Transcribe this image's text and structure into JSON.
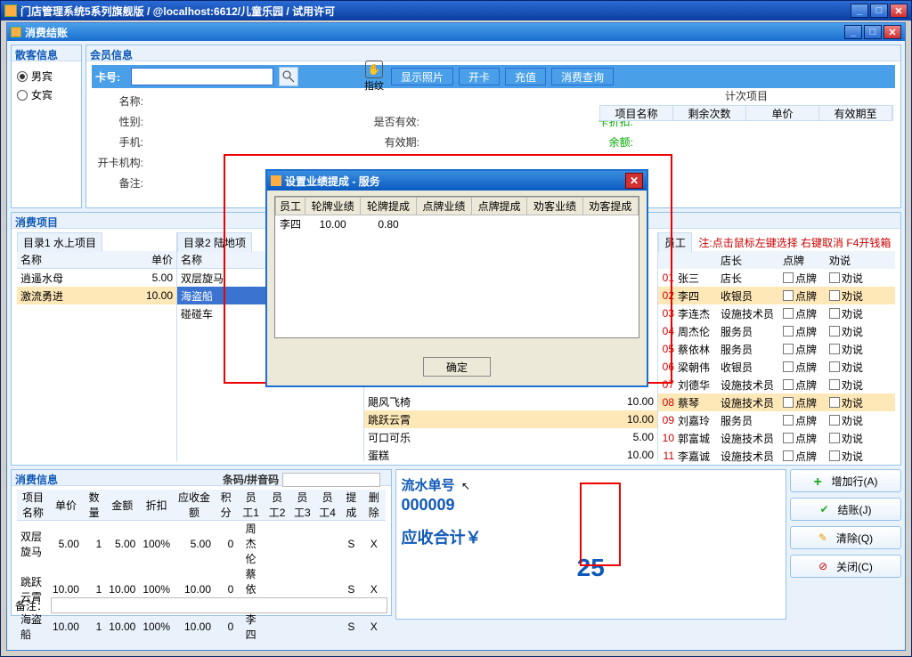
{
  "outer": {
    "title": "门店管理系统5系列旗舰版 / @localhost:6612/儿童乐园 / 试用许可"
  },
  "inner": {
    "title": "消费结账"
  },
  "guest": {
    "header": "散客信息",
    "male": "男宾",
    "female": "女宾"
  },
  "member": {
    "header": "会员信息",
    "labels": {
      "card": "卡号:",
      "name": "名称:",
      "sex": "性别:",
      "phone": "手机:",
      "org": "开卡机构:",
      "remark": "备注:",
      "valid": "是否有效:",
      "exp": "有效期:",
      "discount": "卡折扣:",
      "balance": "余额:"
    },
    "finger": "指纹",
    "btns": {
      "photo": "显示照片",
      "open": "开卡",
      "recharge": "充值",
      "query": "消费查询"
    },
    "count_title": "计次项目",
    "count_cols": [
      "项目名称",
      "剩余次数",
      "单价",
      "有效期至"
    ]
  },
  "xiaofei": {
    "header": "消费项目",
    "tab1": "目录1 水上项目",
    "tab2": "目录2 陆地项",
    "staff_tab": "员工",
    "staff_note": "注:点击鼠标左键选择 右键取消 F4开钱箱",
    "cols": {
      "name": "名称",
      "price": "单价"
    },
    "cat1": [
      {
        "name": "逍遥水母",
        "price": "5.00"
      },
      {
        "name": "激流勇进",
        "price": "10.00",
        "hi": true
      }
    ],
    "cat2": [
      {
        "name": "双层旋马"
      },
      {
        "name": "海盗船",
        "sel": true
      },
      {
        "name": "碰碰车"
      }
    ],
    "cat3": [
      {
        "name": "飓风飞椅",
        "price": "10.00"
      },
      {
        "name": "跳跃云霄",
        "price": "10.00",
        "hi": true
      },
      {
        "name": "可口可乐",
        "price": "5.00"
      },
      {
        "name": "蛋糕",
        "price": "10.00"
      }
    ],
    "staff_cols": [
      "店长",
      "点牌",
      "劝说"
    ],
    "staff": [
      {
        "no": "01",
        "name": "张三",
        "role": "店长"
      },
      {
        "no": "02",
        "name": "李四",
        "role": "收银员",
        "hi": true
      },
      {
        "no": "03",
        "name": "李连杰",
        "role": "设施技术员"
      },
      {
        "no": "04",
        "name": "周杰伦",
        "role": "服务员"
      },
      {
        "no": "05",
        "name": "蔡依林",
        "role": "服务员"
      },
      {
        "no": "06",
        "name": "梁朝伟",
        "role": "收银员"
      },
      {
        "no": "07",
        "name": "刘德华",
        "role": "设施技术员"
      },
      {
        "no": "08",
        "name": "蔡琴",
        "role": "设施技术员",
        "hi": true
      },
      {
        "no": "09",
        "name": "刘嘉玲",
        "role": "服务员"
      },
      {
        "no": "10",
        "name": "郭富城",
        "role": "设施技术员"
      },
      {
        "no": "11",
        "name": "李嘉诚",
        "role": "设施技术员"
      }
    ],
    "pair_labels": {
      "dp": "点牌",
      "qs": "劝说"
    }
  },
  "xinfo": {
    "header": "消费信息",
    "barcode_label": "条码/拼音码",
    "cols": [
      "项目名称",
      "单价",
      "数量",
      "金额",
      "折扣",
      "应收金额",
      "积分",
      "员工1",
      "员工2",
      "员工3",
      "员工4",
      "提成",
      "删除"
    ],
    "rows": [
      {
        "name": "双层旋马",
        "price": "5.00",
        "qty": "1",
        "amt": "5.00",
        "disc": "100%",
        "due": "5.00",
        "pts": "0",
        "e1": "周杰伦",
        "tc": "S",
        "del": "X"
      },
      {
        "name": "跳跃云霄",
        "price": "10.00",
        "qty": "1",
        "amt": "10.00",
        "disc": "100%",
        "due": "10.00",
        "pts": "0",
        "e1": "蔡依林",
        "tc": "S",
        "del": "X"
      },
      {
        "name": "海盗船",
        "price": "10.00",
        "qty": "1",
        "amt": "10.00",
        "disc": "100%",
        "due": "10.00",
        "pts": "0",
        "e1": "李四",
        "tc": "S",
        "del": "X"
      }
    ],
    "remark_label": "备注："
  },
  "summary": {
    "serial_label": "流水单号",
    "serial": "000009",
    "due_label": "应收合计￥",
    "due": "25"
  },
  "actions": {
    "add": "增加行(A)",
    "pay": "结账(J)",
    "clear": "清除(Q)",
    "close": "关闭(C)"
  },
  "modal": {
    "title": "设置业绩提成 - 服务",
    "cols": [
      "员工",
      "轮牌业绩",
      "轮牌提成",
      "点牌业绩",
      "点牌提成",
      "劝客业绩",
      "劝客提成"
    ],
    "row": {
      "name": "李四",
      "a": "10.00",
      "b": "0.80"
    },
    "ok": "确定"
  }
}
